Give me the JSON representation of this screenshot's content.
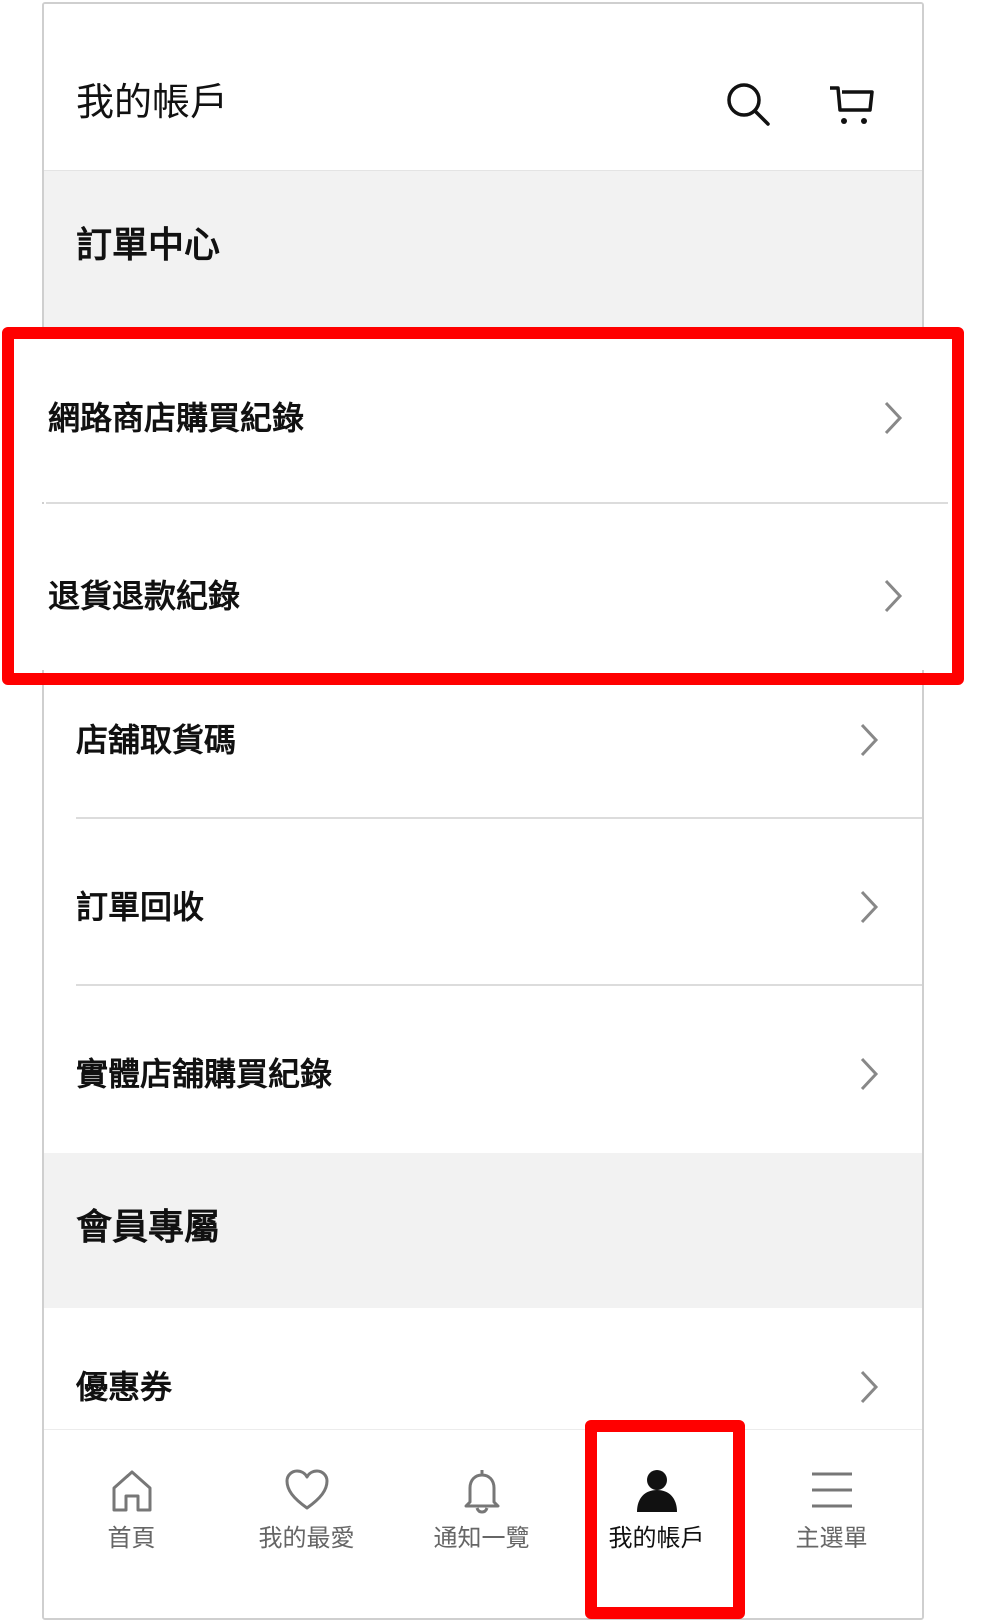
{
  "header": {
    "title": "我的帳戶",
    "search_icon": "search-icon",
    "cart_icon": "cart-icon"
  },
  "order_center": {
    "title": "訂單中心",
    "items": [
      {
        "label": "網路商店購買紀錄"
      },
      {
        "label": "退貨退款紀錄"
      },
      {
        "label": "店舖取貨碼"
      },
      {
        "label": "訂單回收"
      },
      {
        "label": "實體店舖購買紀錄"
      }
    ]
  },
  "member": {
    "title": "會員專屬",
    "items": [
      {
        "label": "優惠券"
      }
    ]
  },
  "bottom_nav": [
    {
      "label": "首頁",
      "icon": "home-icon"
    },
    {
      "label": "我的最愛",
      "icon": "heart-icon"
    },
    {
      "label": "通知一覽",
      "icon": "bell-icon"
    },
    {
      "label": "我的帳戶",
      "icon": "person-icon",
      "active": true
    },
    {
      "label": "主選單",
      "icon": "menu-icon"
    }
  ],
  "colors": {
    "highlight": "#ff0000",
    "section_bg": "#f2f2f2",
    "divider": "#dcdcdc"
  }
}
